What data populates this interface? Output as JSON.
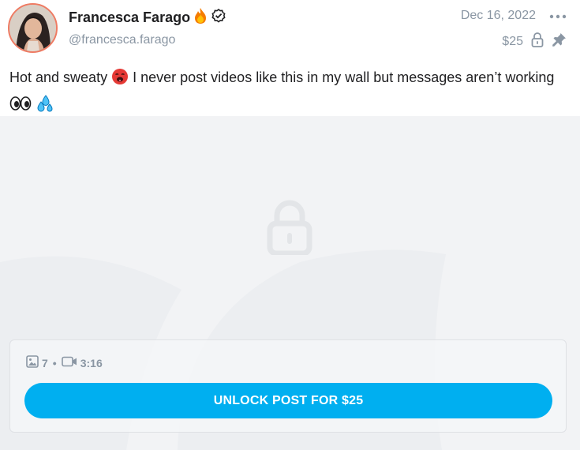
{
  "post": {
    "author_name": "Francesca Farago",
    "username": "@francesca.farago",
    "date": "Dec 16, 2022",
    "price": "$25",
    "text_part1": "Hot and sweaty",
    "text_part2": "I never post videos like this in my wall but messages aren’t working",
    "icons": [
      "fire-icon",
      "verified-icon",
      "more-icon",
      "lock-icon",
      "pin-icon"
    ]
  },
  "media": {
    "image_count": "7",
    "separator": "•",
    "video_duration": "3:16",
    "unlock_label": "UNLOCK POST FOR $25"
  },
  "colors": {
    "accent": "#00aff0",
    "muted_text": "#8a96a3",
    "avatar_ring": "#ef7b63"
  }
}
